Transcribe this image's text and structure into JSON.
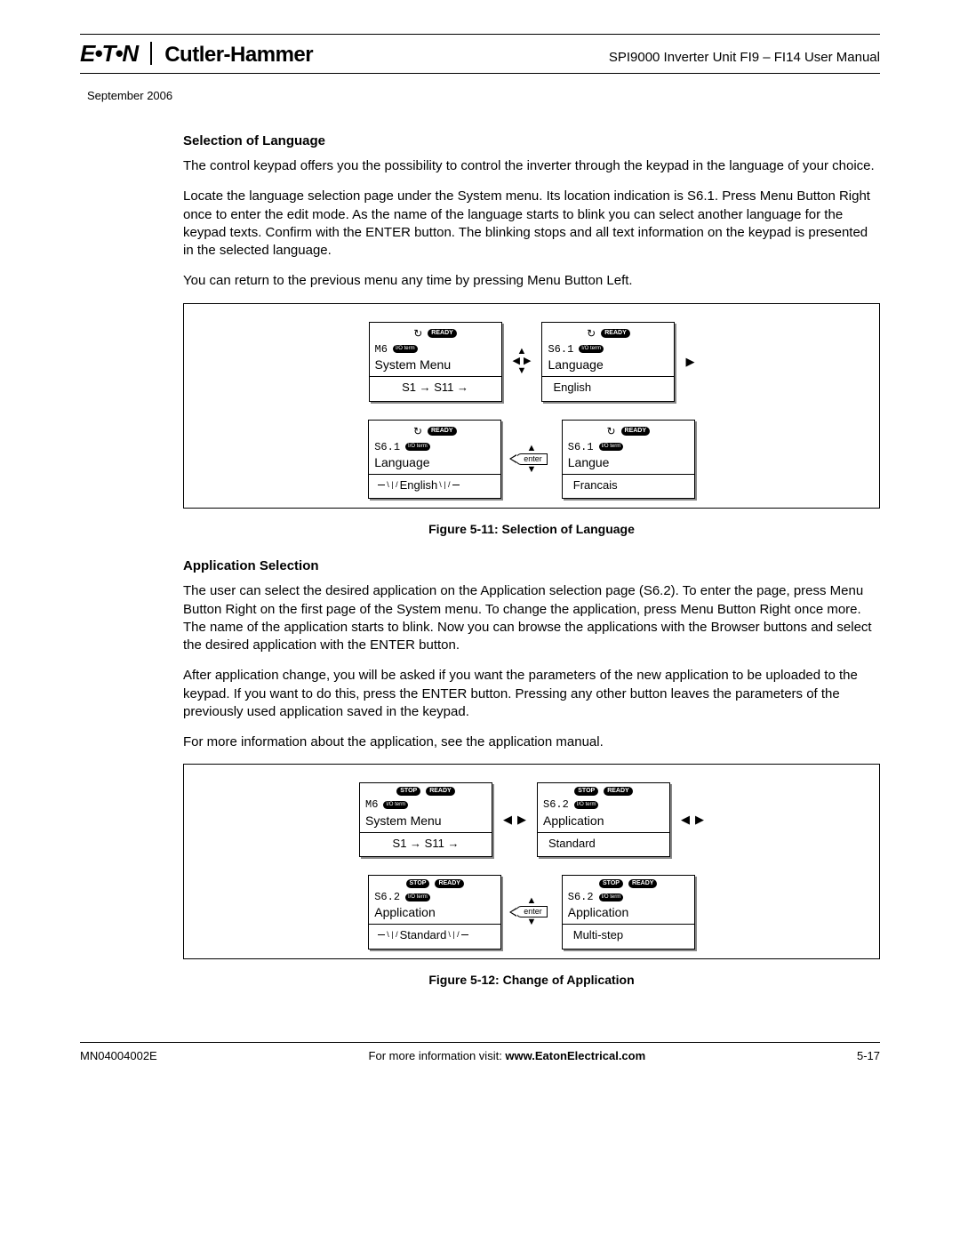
{
  "header": {
    "logo": "E•T•N",
    "brand": "Cutler-Hammer",
    "doc_title": "SPI9000 Inverter Unit FI9 – FI14 User Manual"
  },
  "date": "September 2006",
  "s1": {
    "head": "Selection of Language",
    "p1": "The control keypad offers you the possibility to control the inverter through the keypad in the language of your choice.",
    "p2": "Locate the language selection page under the System menu. Its location indication is S6.1. Press Menu Button Right once to enter the edit mode. As the name of the language starts to blink you can select another language for the keypad texts. Confirm with the ENTER button. The blinking stops and all text information on the keypad is presented in the selected language.",
    "p3": "You can return to the previous menu any time by pressing Menu Button Left."
  },
  "fig1": {
    "caption": "Figure 5-11: Selection of Language",
    "ready": "READY",
    "iosmall": "I/O term",
    "enter": "enter",
    "k1": {
      "code": "M6",
      "main": "System Menu",
      "sub": "S1 → S11 →"
    },
    "k2": {
      "code": "S6.1",
      "main": "Language",
      "sub": "English"
    },
    "k3": {
      "code": "S6.1",
      "main": "Language",
      "sub": "English"
    },
    "k4": {
      "code": "S6.1",
      "main": "Langue",
      "sub": "Francais"
    }
  },
  "s2": {
    "head": "Application Selection",
    "p1": "The user can select the desired application on the Application selection page (S6.2). To enter the page, press Menu Button Right on the first page of the System menu. To change the application, press Menu Button Right once more. The name of the application starts to blink. Now you can browse the applications with the Browser buttons and select the desired application with the ENTER button.",
    "p2": "After application change, you will be asked if you want the parameters of the new application to be uploaded to the keypad. If you want to do this, press the ENTER button. Pressing any other button leaves the parameters of the previously used application saved in the keypad.",
    "p3": "For more information about the application, see the application manual."
  },
  "fig2": {
    "caption": "Figure 5-12: Change of Application",
    "stop": "STOP",
    "ready": "READY",
    "iosmall": "I/O term",
    "enter": "enter",
    "k1": {
      "code": "M6",
      "main": "System Menu",
      "sub": "S1 → S11 →"
    },
    "k2": {
      "code": "S6.2",
      "main": "Application",
      "sub": "Standard"
    },
    "k3": {
      "code": "S6.2",
      "main": "Application",
      "sub": "Standard"
    },
    "k4": {
      "code": "S6.2",
      "main": "Application",
      "sub": "Multi-step"
    }
  },
  "footer": {
    "left": "MN04004002E",
    "mid_pre": "For more information visit: ",
    "mid_bold": "www.EatonElectrical.com",
    "right": "5-17"
  }
}
